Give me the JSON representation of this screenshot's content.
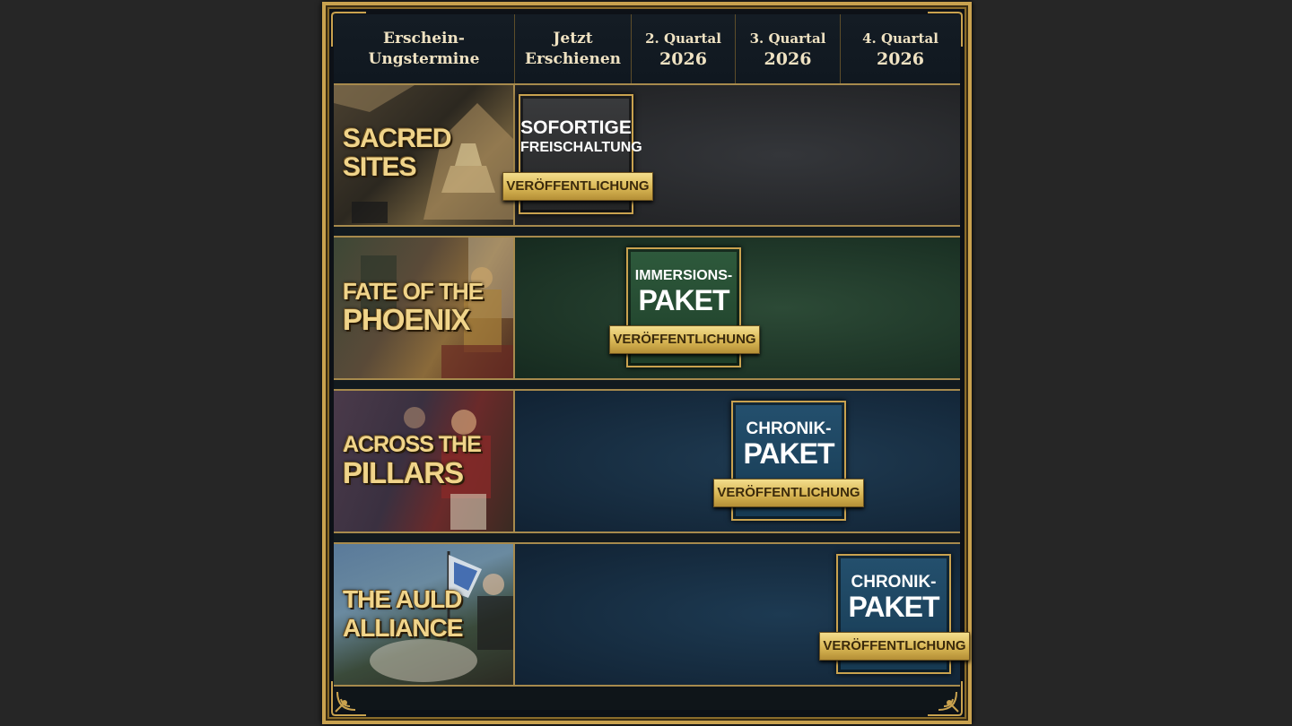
{
  "header": {
    "release_dates": "Erschein-\nUngstermine",
    "now_released": "Jetzt\nErschienen",
    "quarters": [
      {
        "quarter": "2. Quartal",
        "year": "2026"
      },
      {
        "quarter": "3. Quartal",
        "year": "2026"
      },
      {
        "quarter": "4. Quartal",
        "year": "2026"
      }
    ]
  },
  "rows": [
    {
      "title_line1": "SACRED",
      "title_line2": "SITES",
      "card_line1": "SOFORTIGE",
      "card_line2": "FREISCHALTUNG",
      "badge": "VERÖFFENTLICHUNG",
      "column": "Jetzt Erschienen",
      "bg_color": "#2a2b2c"
    },
    {
      "title_line1": "FATE OF THE",
      "title_line2": "PHOENIX",
      "card_line1": "IMMERSIONS-",
      "card_line2": "PAKET",
      "badge": "VERÖFFENTLICHUNG",
      "column": "2. Quartal 2026",
      "bg_color": "#1f3a2b"
    },
    {
      "title_line1": "ACROSS THE",
      "title_line2": "PILLARS",
      "card_line1": "CHRONIK-",
      "card_line2": "PAKET",
      "badge": "VERÖFFENTLICHUNG",
      "column": "3. Quartal 2026",
      "bg_color": "#14293a"
    },
    {
      "title_line1": "THE AULD",
      "title_line2": "ALLIANCE",
      "card_line1": "CHRONIK-",
      "card_line2": "PAKET",
      "badge": "VERÖFFENTLICHUNG",
      "column": "4. Quartal 2026",
      "bg_color": "#13273a"
    }
  ],
  "colors": {
    "gold_frame": "#c9a24f",
    "header_text": "#efe2c2",
    "title_gold": "#f0d48a"
  }
}
